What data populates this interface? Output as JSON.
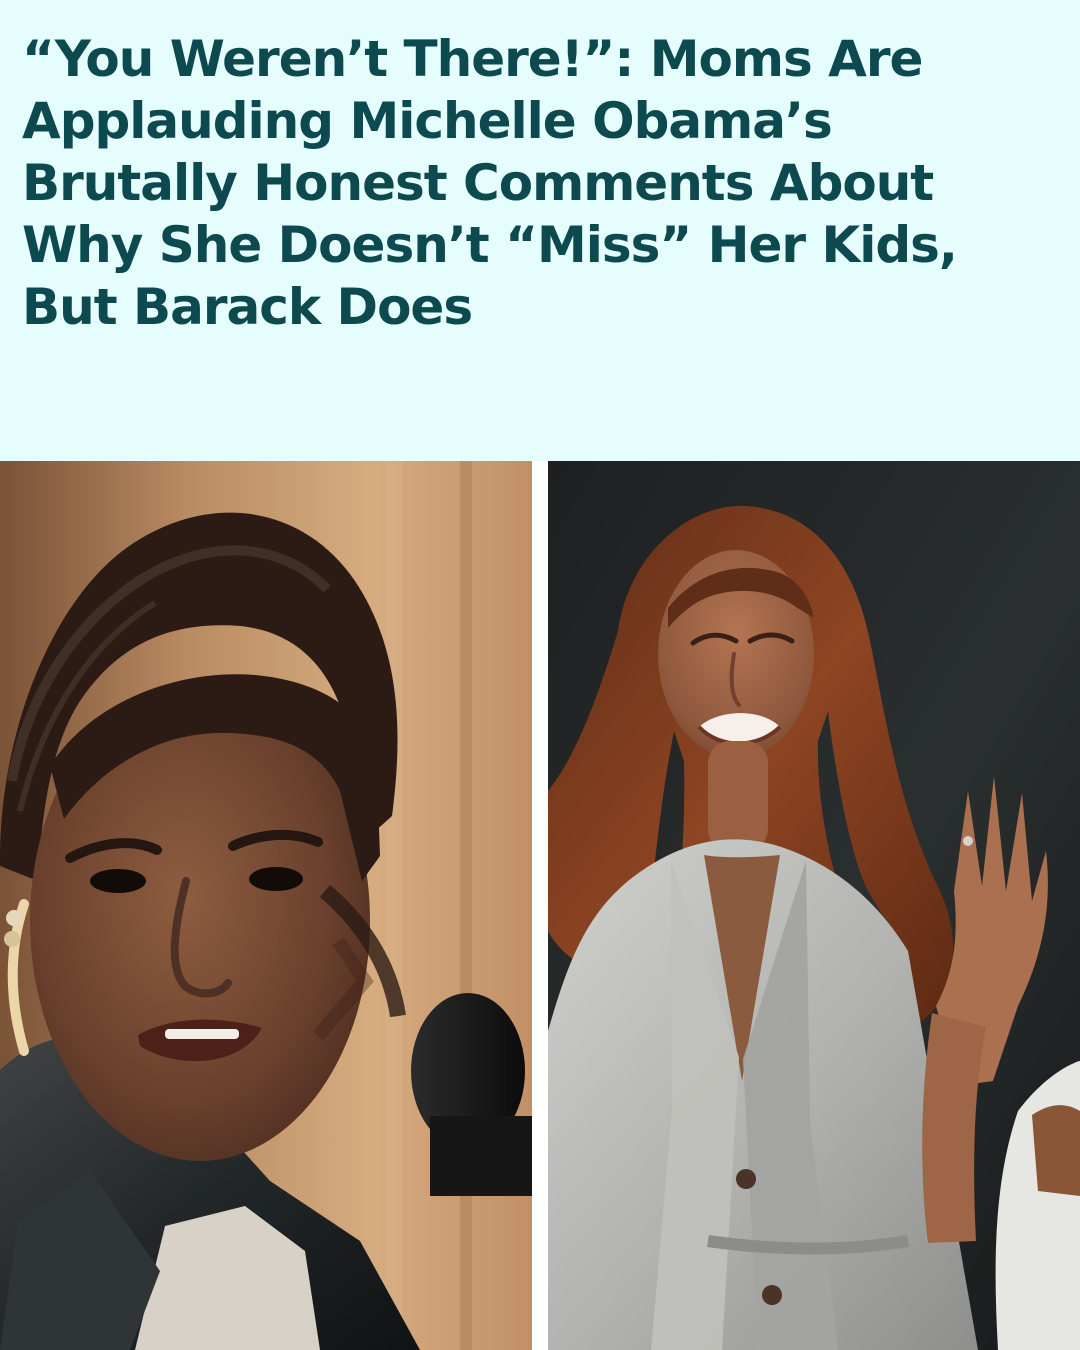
{
  "article": {
    "headline": "“You Weren’t There!”: Moms Are Applauding Michelle Obama’s Brutally Honest Comments About Why She Doesn’t “Miss” Her Kids, But Barack Does"
  },
  "colors": {
    "background": "#e6fdfd",
    "headline": "#0d4a4f",
    "divider": "#ffffff"
  }
}
